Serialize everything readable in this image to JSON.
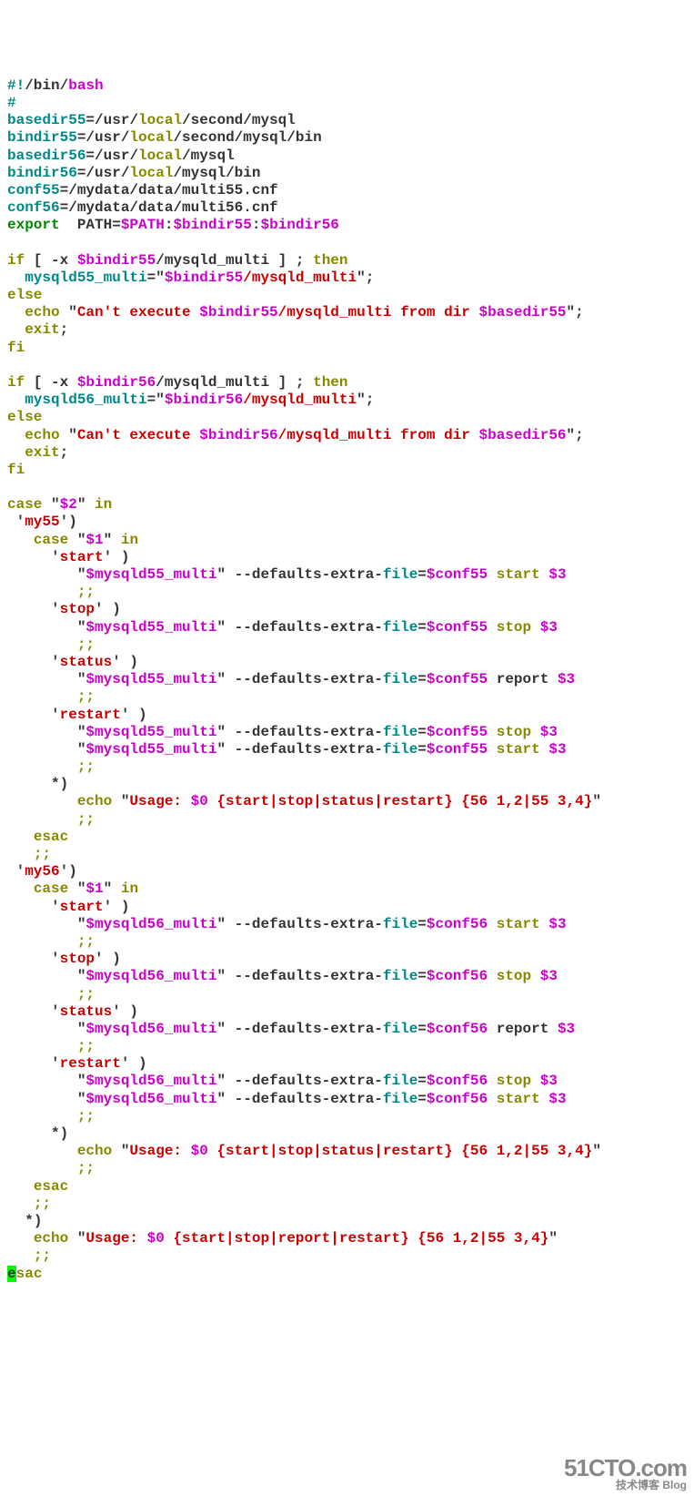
{
  "l1_a": "#!",
  "l1_b": "/bin/",
  "l1_c": "bash",
  "l2": "#",
  "l3_a": "basedir55",
  "l3_b": "=",
  "l3_c": "/usr/",
  "l3_d": "local",
  "l3_e": "/second/mysql",
  "l4_a": "bindir55",
  "l4_b": "=",
  "l4_c": "/usr/",
  "l4_d": "local",
  "l4_e": "/second/mysql/bin",
  "l5_a": "basedir56",
  "l5_b": "=",
  "l5_c": "/usr/",
  "l5_d": "local",
  "l5_e": "/mysql",
  "l6_a": "bindir56",
  "l6_b": "=",
  "l6_c": "/usr/",
  "l6_d": "local",
  "l6_e": "/mysql/bin",
  "l7_a": "conf55",
  "l7_b": "=",
  "l7_c": "/mydata/data/multi55.cnf",
  "l8_a": "conf56",
  "l8_b": "=",
  "l8_c": "/mydata/data/multi56.cnf",
  "l9_a": "export",
  "l9_b": "  PATH=",
  "l9_c": "$PATH",
  "l9_d": ":",
  "l9_e": "$bindir55",
  "l9_f": ":",
  "l9_g": "$bindir56",
  "l11_a": "if",
  "l11_b": " [ -x ",
  "l11_c": "$bindir55",
  "l11_d": "/mysqld_multi ",
  "l11_e": "]",
  " l11_sp": " ",
  "l11_f": ";",
  " l11_g": "then",
  "l12_a": "  ",
  "l12_b": "mysqld55_multi",
  "l12_c": "=",
  "l12_d": "\"",
  "l12_e": "$bindir55",
  "l12_f": "/mysqld_multi",
  "l12_g": "\"",
  "l12_h": ";",
  "l13": "else",
  "l14_a": "  ",
  "l14_b": "echo",
  "l14_c": " \"",
  "l14_d": "Can't execute ",
  "l14_e": "$bindir55",
  "l14_f": "/mysqld_multi from dir ",
  "l14_g": "$basedir55",
  "l14_h": "\"",
  "l14_i": ";",
  "l15_a": "  ",
  "l15_b": "exit",
  "l15_c": ";",
  "l16": "fi",
  "l18_a": "if",
  "l18_b": " [ -x ",
  "l18_c": "$bindir56",
  "l18_d": "/mysqld_multi ",
  "l18_e": "]",
  "l18_f": ";",
  " l18_g": "then",
  "l19_a": "  ",
  "l19_b": "mysqld56_multi",
  "l19_c": "=",
  "l19_d": "\"",
  "l19_e": "$bindir56",
  "l19_f": "/mysqld_multi",
  "l19_g": "\"",
  "l19_h": ";",
  "l20": "else",
  "l21_a": "  ",
  "l21_b": "echo",
  "l21_c": " \"",
  "l21_d": "Can't execute ",
  "l21_e": "$bindir56",
  "l21_f": "/mysqld_multi from dir ",
  "l21_g": "$basedir56",
  "l21_h": "\"",
  "l21_i": ";",
  "l22_a": "  ",
  "l22_b": "exit",
  "l22_c": ";",
  "l23": "fi",
  "l25_a": "case",
  "l25_b": " \"",
  "l25_c": "$2",
  "l25_d": "\"",
  "l25_e": " in",
  "l26_a": " '",
  "l26_b": "my55",
  "l26_c": "'",
  "l26_d": ")",
  "l27_a": "   ",
  "l27_b": "case",
  "l27_c": " \"",
  "l27_d": "$1",
  "l27_e": "\"",
  "l27_f": " in",
  "l28_a": "     '",
  "l28_b": "start",
  "l28_c": "'",
  "l28_d": " )",
  "l29_a": "        \"",
  "l29_b": "$mysqld55_multi",
  "l29_c": "\"",
  "l29_d": " --defaults-extra-",
  "l29_e": "file",
  "l29_f": "=",
  "l29_g": "$conf55",
  "l29_h": " start ",
  "l29_i": "$3",
  "l30_a": "        ",
  "l30_b": ";;",
  "l31_a": "     '",
  "l31_b": "stop",
  "l31_c": "'",
  "l31_d": " )",
  "l32_a": "        \"",
  "l32_b": "$mysqld55_multi",
  "l32_c": "\"",
  "l32_d": " --defaults-extra-",
  "l32_e": "file",
  "l32_f": "=",
  "l32_g": "$conf55",
  "l32_h": " stop ",
  "l32_i": "$3",
  "l33_a": "        ",
  "l33_b": ";;",
  "l34_a": "     '",
  "l34_b": "status",
  "l34_c": "'",
  "l34_d": " )",
  "l35_a": "        \"",
  "l35_b": "$mysqld55_multi",
  "l35_c": "\"",
  "l35_d": " --defaults-extra-",
  "l35_e": "file",
  "l35_f": "=",
  "l35_g": "$conf55",
  "l35_h": " report ",
  "l35_i": "$3",
  "l36_a": "        ",
  "l36_b": ";;",
  "l37_a": "     '",
  "l37_b": "restart",
  "l37_c": "'",
  "l37_d": " )",
  "l38_a": "        \"",
  "l38_b": "$mysqld55_multi",
  "l38_c": "\"",
  "l38_d": " --defaults-extra-",
  "l38_e": "file",
  "l38_f": "=",
  "l38_g": "$conf55",
  "l38_h": " stop ",
  "l38_i": "$3",
  "l39_a": "        \"",
  "l39_b": "$mysqld55_multi",
  "l39_c": "\"",
  "l39_d": " --defaults-extra-",
  "l39_e": "file",
  "l39_f": "=",
  "l39_g": "$conf55",
  "l39_h": " start ",
  "l39_i": "$3",
  "l40_a": "        ",
  "l40_b": ";;",
  "l41_a": "     *",
  "l41_b": ")",
  "l42_a": "        ",
  "l42_b": "echo",
  "l42_c": " \"",
  "l42_d": "Usage: ",
  "l42_e": "$0",
  "l42_f": " {start|stop|status|restart} {56 1,2|55 3,4}",
  "l42_g": "\"",
  "l43_a": "        ",
  "l43_b": ";;",
  "l44_a": "   ",
  "l44_b": "esac",
  "l45_a": "   ",
  "l45_b": ";;",
  "l46_a": " '",
  "l46_b": "my56",
  "l46_c": "'",
  "l46_d": ")",
  "l47_a": "   ",
  "l47_b": "case",
  "l47_c": " \"",
  "l47_d": "$1",
  "l47_e": "\"",
  "l47_f": " in",
  "l48_a": "     '",
  "l48_b": "start",
  "l48_c": "'",
  "l48_d": " )",
  "l49_a": "        \"",
  "l49_b": "$mysqld56_multi",
  "l49_c": "\"",
  "l49_d": " --defaults-extra-",
  "l49_e": "file",
  "l49_f": "=",
  "l49_g": "$conf56",
  "l49_h": " start ",
  "l49_i": "$3",
  "l50_a": "        ",
  "l50_b": ";;",
  "l51_a": "     '",
  "l51_b": "stop",
  "l51_c": "'",
  "l51_d": " )",
  "l52_a": "        \"",
  "l52_b": "$mysqld56_multi",
  "l52_c": "\"",
  "l52_d": " --defaults-extra-",
  "l52_e": "file",
  "l52_f": "=",
  "l52_g": "$conf56",
  "l52_h": " stop ",
  "l52_i": "$3",
  "l53_a": "        ",
  "l53_b": ";;",
  "l54_a": "     '",
  "l54_b": "status",
  "l54_c": "'",
  "l54_d": " )",
  "l55_a": "        \"",
  "l55_b": "$mysqld56_multi",
  "l55_c": "\"",
  "l55_d": " --defaults-extra-",
  "l55_e": "file",
  "l55_f": "=",
  "l55_g": "$conf56",
  "l55_h": " report ",
  "l55_i": "$3",
  "l56_a": "        ",
  "l56_b": ";;",
  "l57_a": "     '",
  "l57_b": "restart",
  "l57_c": "'",
  "l57_d": " )",
  "l58_a": "        \"",
  "l58_b": "$mysqld56_multi",
  "l58_c": "\"",
  "l58_d": " --defaults-extra-",
  "l58_e": "file",
  "l58_f": "=",
  "l58_g": "$conf56",
  "l58_h": " stop ",
  "l58_i": "$3",
  "l59_a": "        \"",
  "l59_b": "$mysqld56_multi",
  "l59_c": "\"",
  "l59_d": " --defaults-extra-",
  "l59_e": "file",
  "l59_f": "=",
  "l59_g": "$conf56",
  "l59_h": " start ",
  "l59_i": "$3",
  "l60_a": "        ",
  "l60_b": ";;",
  "l61_a": "     *",
  "l61_b": ")",
  "l62_a": "        ",
  "l62_b": "echo",
  "l62_c": " \"",
  "l62_d": "Usage: ",
  "l62_e": "$0",
  "l62_f": " {start|stop|status|restart} {56 1,2|55 3,4}",
  "l62_g": "\"",
  "l63_a": "        ",
  "l63_b": ";;",
  "l64_a": "   ",
  "l64_b": "esac",
  "l65_a": "   ",
  "l65_b": ";;",
  "l66_a": "  *",
  "l66_b": ")",
  "l67_a": "   ",
  "l67_b": "echo",
  "l67_c": " \"",
  "l67_d": "Usage: ",
  "l67_e": "$0",
  "l67_f": " {start|stop|report|restart} {56 1,2|55 3,4}",
  "l67_g": "\"",
  "l68_a": "   ",
  "l68_b": ";;",
  "l69_cursor": "e",
  "l69_b": "sac",
  "watermark_big": "51CTO.com",
  "watermark_small": "技术博客   Blog"
}
